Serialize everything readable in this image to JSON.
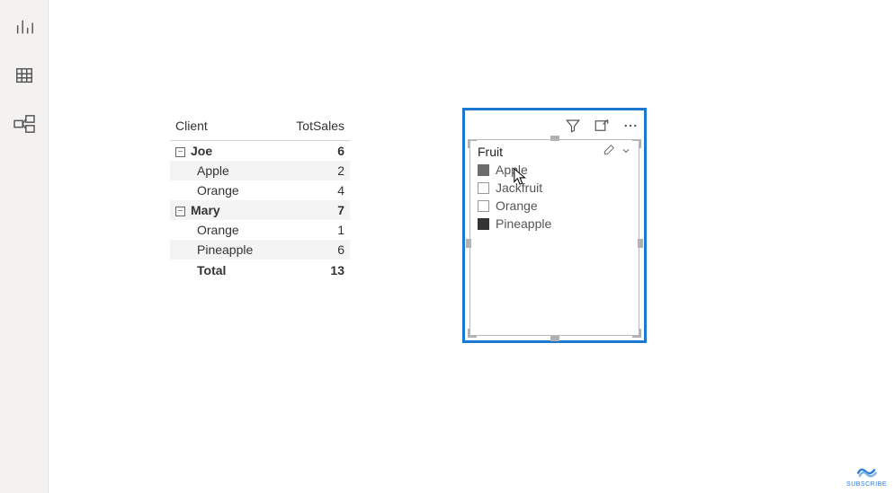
{
  "nav": {
    "items": [
      "report-view",
      "data-view",
      "model-view"
    ]
  },
  "matrix": {
    "columns": [
      "Client",
      "TotSales"
    ],
    "groups": [
      {
        "name": "Joe",
        "subtotal": 6,
        "rows": [
          {
            "label": "Apple",
            "value": 2
          },
          {
            "label": "Orange",
            "value": 4
          }
        ]
      },
      {
        "name": "Mary",
        "subtotal": 7,
        "rows": [
          {
            "label": "Orange",
            "value": 1
          },
          {
            "label": "Pineapple",
            "value": 6
          }
        ]
      }
    ],
    "total_label": "Total",
    "total_value": 13
  },
  "slicer": {
    "title": "Fruit",
    "items": [
      {
        "label": "Apple",
        "state": "mid"
      },
      {
        "label": "Jackfruit",
        "state": "none"
      },
      {
        "label": "Orange",
        "state": "none"
      },
      {
        "label": "Pineapple",
        "state": "dark"
      }
    ]
  },
  "watermark": {
    "label": "SUBSCRIBE"
  }
}
